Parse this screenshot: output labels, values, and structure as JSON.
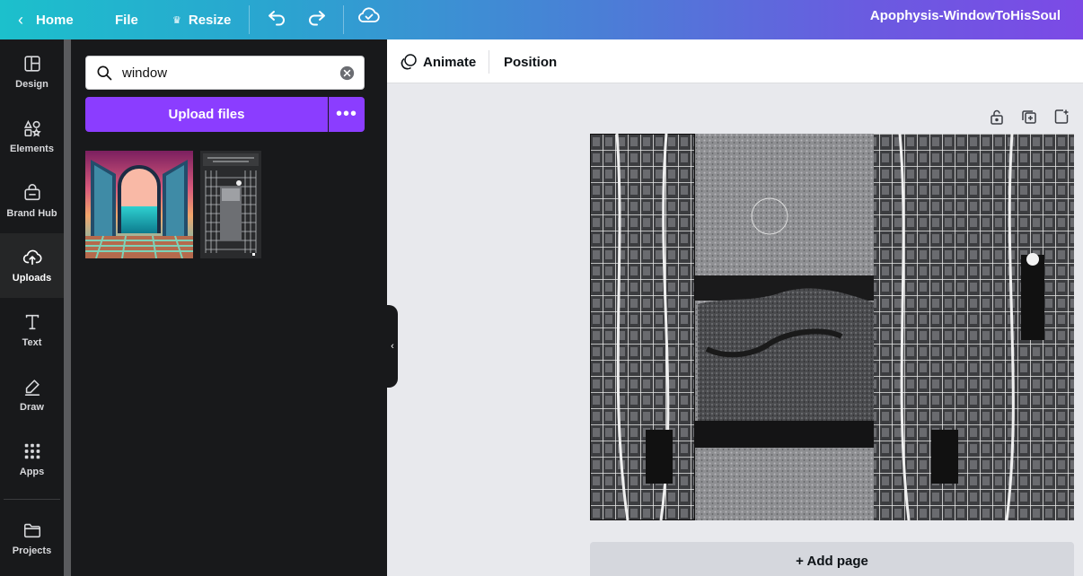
{
  "topbar": {
    "home_label": "Home",
    "file_label": "File",
    "resize_label": "Resize",
    "crown_glyph": "♛",
    "undo_icon": "undo-icon",
    "redo_icon": "redo-icon",
    "cloud_icon": "cloud-check-icon",
    "design_title": "Apophysis-WindowToHisSoul"
  },
  "rail": {
    "items": [
      {
        "label": "Design",
        "icon": "layout-icon"
      },
      {
        "label": "Elements",
        "icon": "shapes-icon"
      },
      {
        "label": "Brand Hub",
        "icon": "brand-hub-icon"
      },
      {
        "label": "Uploads",
        "icon": "cloud-upload-icon"
      },
      {
        "label": "Text",
        "icon": "text-icon"
      },
      {
        "label": "Draw",
        "icon": "draw-icon"
      },
      {
        "label": "Apps",
        "icon": "apps-grid-icon"
      },
      {
        "label": "Projects",
        "icon": "folder-icon"
      }
    ]
  },
  "panel": {
    "search_value": "window",
    "search_placeholder": "Search",
    "upload_label": "Upload files",
    "more_glyph": "•••",
    "collapse_glyph": "‹"
  },
  "toolbar": {
    "animate_label": "Animate",
    "position_label": "Position"
  },
  "canvas": {
    "add_page_label": "+ Add page"
  },
  "colors": {
    "accent": "#8b3dff",
    "sidebar_bg": "#18191b",
    "canvas_bg": "#e8e9ed"
  }
}
